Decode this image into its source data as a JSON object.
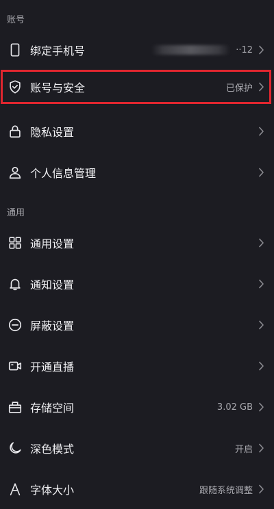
{
  "sections": {
    "account": "账号",
    "general": "通用"
  },
  "account_items": {
    "phone": {
      "label": "绑定手机号",
      "value_tail": "··12"
    },
    "security": {
      "label": "账号与安全",
      "value": "已保护"
    },
    "privacy": {
      "label": "隐私设置"
    },
    "personal_info": {
      "label": "个人信息管理"
    }
  },
  "general_items": {
    "general_settings": {
      "label": "通用设置"
    },
    "notifications": {
      "label": "通知设置"
    },
    "block": {
      "label": "屏蔽设置"
    },
    "live": {
      "label": "开通直播"
    },
    "storage": {
      "label": "存储空间",
      "value": "3.02 GB"
    },
    "dark_mode": {
      "label": "深色模式",
      "value": "开启"
    },
    "font_size": {
      "label": "字体大小",
      "value": "跟随系统调整"
    }
  },
  "colors": {
    "background": "#1c1c22",
    "highlight_border": "#e0262f",
    "text_primary": "#efeff2",
    "text_secondary": "#a8a8ae"
  },
  "icons": {
    "phone": "phone-icon",
    "security": "shield-check-icon",
    "privacy": "lock-icon",
    "personal_info": "person-icon",
    "general_settings": "grid-icon",
    "notifications": "bell-icon",
    "block": "block-icon",
    "live": "video-camera-icon",
    "storage": "storage-box-icon",
    "dark_mode": "moon-icon",
    "font_size": "font-icon"
  }
}
